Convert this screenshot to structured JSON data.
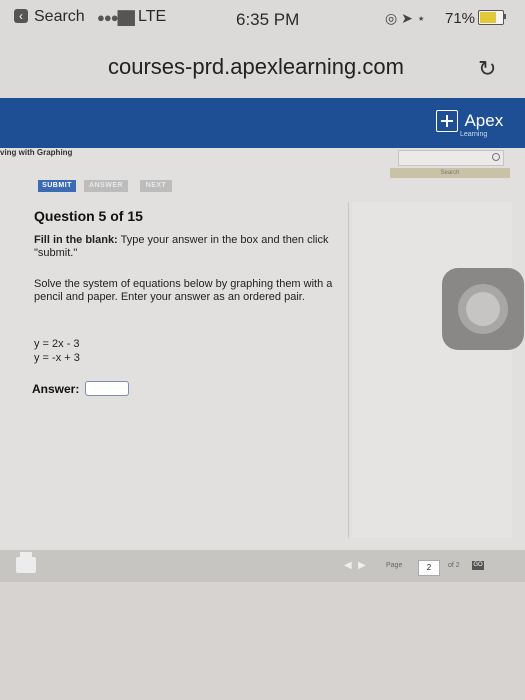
{
  "status_bar": {
    "back_label": "Search",
    "carrier": "LTE",
    "time": "6:35 PM",
    "battery_percent": "71%",
    "battery_level": 0.71
  },
  "browser": {
    "url": "courses-prd.apexlearning.com"
  },
  "header": {
    "brand": "Apex",
    "brand_sub": "Learning"
  },
  "breadcrumb": "ving with Graphing",
  "search_tab_label": "Search",
  "buttons": {
    "submit": "SUBMIT",
    "answer": "ANSWER",
    "next": "NEXT"
  },
  "question": {
    "title": "Question 5 of 15",
    "instruction_bold": "Fill in the blank:",
    "instruction_rest": " Type your answer in the box and then click \"submit.\"",
    "prompt": "Solve the system of equations below by graphing them with a pencil and paper. Enter your answer as an ordered pair.",
    "equations": [
      "y = 2x - 3",
      "y = -x + 3"
    ],
    "answer_label": "Answer:",
    "answer_value": ""
  },
  "pagination": {
    "page_label": "Page",
    "current_page": "2",
    "of_label": "of 2",
    "go_label": "GO"
  }
}
